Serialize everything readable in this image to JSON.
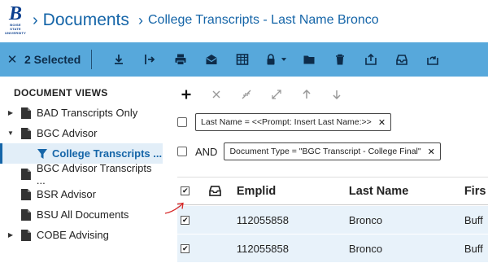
{
  "header": {
    "logo": {
      "letter": "B",
      "text": "BOISE STATE UNIVERSITY"
    },
    "breadcrumb": [
      {
        "label": "Documents"
      },
      {
        "label": "College Transcripts - Last Name Bronco"
      }
    ]
  },
  "toolbar": {
    "close_icon": "close-icon",
    "selected_label": "2 Selected",
    "icons": [
      "download-icon",
      "move-icon",
      "print-icon",
      "email-icon",
      "table-icon",
      "lock-icon",
      "folder-icon",
      "trash-icon",
      "archive-up-icon",
      "inbox-icon",
      "sync-icon"
    ]
  },
  "sidebar": {
    "title": "DOCUMENT VIEWS",
    "items": [
      {
        "label": "BAD Transcripts Only",
        "arrow": "right"
      },
      {
        "label": "BGC Advisor",
        "arrow": "down"
      },
      {
        "label": "College Transcripts ...",
        "selected": true
      },
      {
        "label": "BGC Advisor Transcripts ..."
      },
      {
        "label": "BSR Advisor"
      },
      {
        "label": "BSU All Documents"
      },
      {
        "label": "COBE Advising",
        "arrow": "right"
      }
    ]
  },
  "query": {
    "conditions": [
      {
        "text": "Last Name = <<Prompt: Insert Last Name:>>"
      },
      {
        "prefix": "AND",
        "text": "Document Type = \"BGC Transcript - College Final\""
      }
    ]
  },
  "grid": {
    "columns": [
      "Emplid",
      "Last Name",
      "Firs"
    ],
    "rows": [
      {
        "emplid": "112055858",
        "last_name": "Bronco",
        "first_name": "Buff"
      },
      {
        "emplid": "112055858",
        "last_name": "Bronco",
        "first_name": "Buff"
      }
    ]
  },
  "colors": {
    "accent": "#1565a8",
    "toolbar": "#57a8db",
    "row_highlight": "#e8f2fa"
  }
}
